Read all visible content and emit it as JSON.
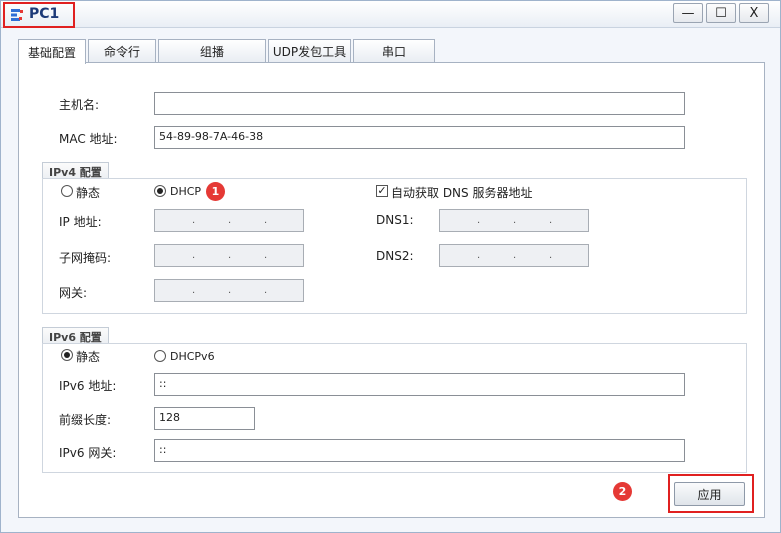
{
  "window": {
    "title": "PC1",
    "controls": {
      "minimize": "—",
      "maximize": "☐",
      "close": "X"
    }
  },
  "tabs": [
    "基础配置",
    "命令行",
    "组播",
    "UDP发包工具",
    "串口"
  ],
  "basic": {
    "hostname_label": "主机名:",
    "hostname_value": "",
    "mac_label": "MAC 地址:",
    "mac_value": "54-89-98-7A-46-38"
  },
  "ipv4": {
    "group_title": "IPv4 配置",
    "static_label": "静态",
    "dhcp_label": "DHCP",
    "dhcp_selected": true,
    "auto_dns_label": "自动获取 DNS 服务器地址",
    "auto_dns_checked": true,
    "ip_label": "IP 地址:",
    "mask_label": "子网掩码:",
    "gateway_label": "网关:",
    "dns1_label": "DNS1:",
    "dns2_label": "DNS2:",
    "ip_separator": "."
  },
  "ipv6": {
    "group_title": "IPv6 配置",
    "static_label": "静态",
    "dhcpv6_label": "DHCPv6",
    "static_selected": true,
    "address_label": "IPv6 地址:",
    "address_value": "::",
    "prefix_label": "前缀长度:",
    "prefix_value": "128",
    "gateway_label": "IPv6 网关:",
    "gateway_value": "::"
  },
  "apply_label": "应用",
  "annotations": {
    "step1": "1",
    "step2": "2"
  },
  "colors": {
    "highlight": "#e02020",
    "badge": "#e53935",
    "title": "#1d3a78"
  }
}
